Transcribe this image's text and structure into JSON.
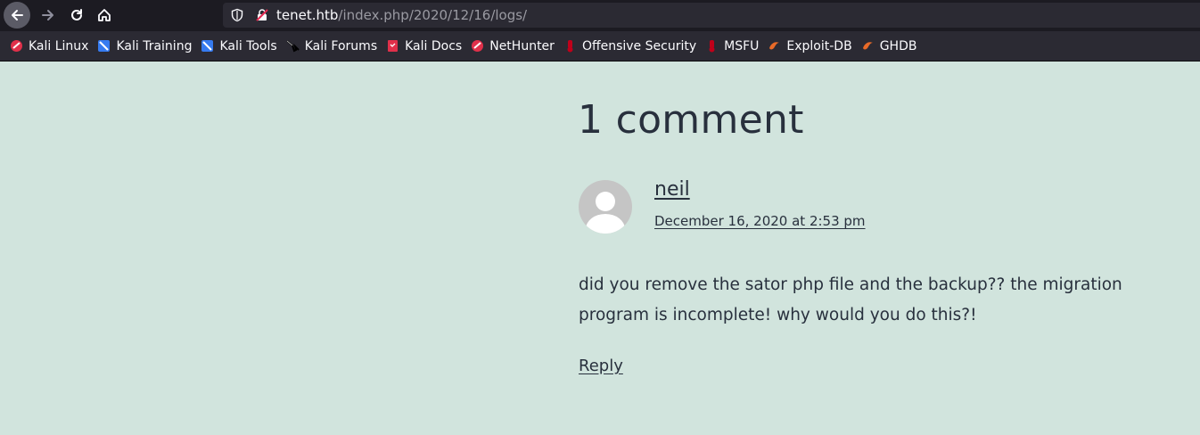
{
  "browser": {
    "url_host": "tenet.htb",
    "url_path": "/index.php/2020/12/16/logs/"
  },
  "bookmarks": [
    {
      "label": "Kali Linux",
      "icon": "kali-icon",
      "color": "#e0304a"
    },
    {
      "label": "Kali Training",
      "icon": "kali-training-icon",
      "color": "#367bf0"
    },
    {
      "label": "Kali Tools",
      "icon": "kali-tools-icon",
      "color": "#367bf0"
    },
    {
      "label": "Kali Forums",
      "icon": "kali-dragon-icon",
      "color": "#000000"
    },
    {
      "label": "Kali Docs",
      "icon": "kali-docs-icon",
      "color": "#e0304a"
    },
    {
      "label": "NetHunter",
      "icon": "nethunter-icon",
      "color": "#e0304a"
    },
    {
      "label": "Offensive Security",
      "icon": "offsec-icon",
      "color": "#c0001a"
    },
    {
      "label": "MSFU",
      "icon": "msfu-icon",
      "color": "#c0001a"
    },
    {
      "label": "Exploit-DB",
      "icon": "exploit-db-icon",
      "color": "#e86a28"
    },
    {
      "label": "GHDB",
      "icon": "ghdb-icon",
      "color": "#e86a28"
    }
  ],
  "comments": {
    "heading": "1 comment",
    "author": "neil",
    "date": "December 16, 2020 at 2:53 pm",
    "text": "did you remove the sator php file and the backup?? the migration program is incomplete! why would you do this?!",
    "reply_label": "Reply"
  },
  "colors": {
    "page_background": "#d1e4dd",
    "text": "#28303d",
    "toolbar": "#1c1b22",
    "urlbar": "#2b2a33"
  }
}
